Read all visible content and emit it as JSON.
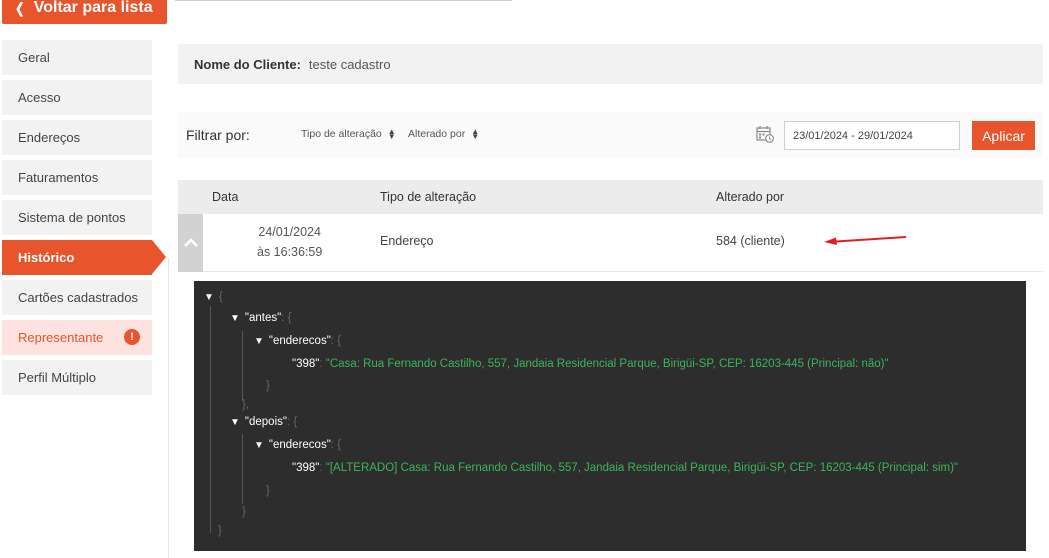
{
  "back_button": {
    "label": "Voltar para lista"
  },
  "sidebar": {
    "items": [
      {
        "label": "Geral"
      },
      {
        "label": "Acesso"
      },
      {
        "label": "Endereços"
      },
      {
        "label": "Faturamentos"
      },
      {
        "label": "Sistema de pontos"
      },
      {
        "label": "Histórico",
        "active": true
      },
      {
        "label": "Cartões cadastrados"
      },
      {
        "label": "Representante",
        "badge": "!"
      },
      {
        "label": "Perfil Múltiplo"
      }
    ]
  },
  "client": {
    "label": "Nome do Cliente:",
    "value": "teste cadastro"
  },
  "filter": {
    "label": "Filtrar por:",
    "options": [
      "Tipo de alteração",
      "Alterado por"
    ],
    "date_range": "23/01/2024 - 29/01/2024",
    "apply_label": "Aplicar"
  },
  "table": {
    "headers": [
      "Data",
      "Tipo de alteração",
      "Alterado por"
    ],
    "row": {
      "date": "24/01/2024",
      "time": "às 16:36:59",
      "type": "Endereço",
      "changed_by": "584 (cliente)"
    }
  },
  "json_view": {
    "open_brace": "{",
    "key_antes": "\"antes\"",
    "key_enderecos_1": "\"enderecos\"",
    "key_398_1": "\"398\"",
    "value_1": "\"Casa: Rua Fernando Castilho, 557, Jandaia Residencial Parque, Birigüi-SP, CEP: 16203-445 (Principal: não)\"",
    "key_depois": "\"depois\"",
    "key_enderecos_2": "\"enderecos\"",
    "key_398_2": "\"398\"",
    "value_2": "\"[ALTERADO] Casa: Rua Fernando Castilho, 557, Jandaia Residencial Parque, Birigüi-SP, CEP: 16203-445 (Principal: sim)\"",
    "close_brace": "}",
    "close_brace_comma": "},",
    "colon_brace": ": {",
    "colon": ":"
  },
  "colors": {
    "accent": "#e8552d",
    "json_bg": "#2d2d2d",
    "json_string": "#3cb55a",
    "arrow": "#e02020"
  }
}
